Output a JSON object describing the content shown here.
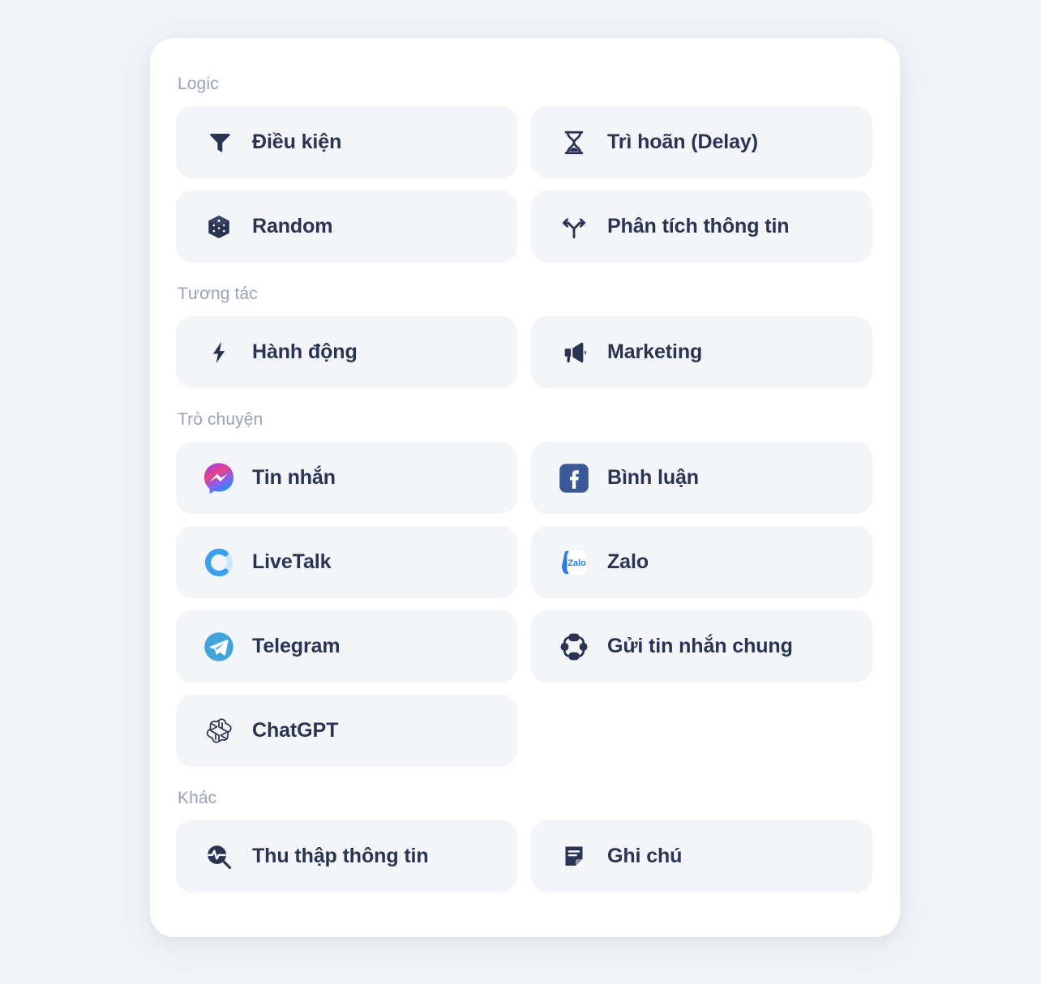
{
  "theme": {
    "page_background": "#f2f4f8",
    "card_background": "#ffffff",
    "tile_background": "#f4f5f9",
    "label_color": "#2a3452",
    "section_title_color": "#9aa2b4",
    "messenger_gradient_start": "#9b4bf5",
    "messenger_gradient_mid": "#f0447a",
    "messenger_gradient_end": "#1292ff",
    "facebook_blue": "#3b5998",
    "telegram_blue": "#41a5dd",
    "livetalk_blue": "#3ba0f0",
    "zalo_blue": "#2a7ce8"
  },
  "sections": [
    {
      "title": "Logic",
      "items": [
        {
          "label": "Điều kiện",
          "icon": "filter-icon"
        },
        {
          "label": "Trì hoãn (Delay)",
          "icon": "hourglass-icon"
        },
        {
          "label": "Random",
          "icon": "dice-icon"
        },
        {
          "label": "Phân tích thông tin",
          "icon": "split-arrows-icon"
        }
      ]
    },
    {
      "title": "Tương tác",
      "items": [
        {
          "label": "Hành động",
          "icon": "lightning-bolt-icon"
        },
        {
          "label": "Marketing",
          "icon": "megaphone-icon"
        }
      ]
    },
    {
      "title": "Trò chuyện",
      "items": [
        {
          "label": "Tin nhắn",
          "icon": "messenger-icon"
        },
        {
          "label": "Bình luận",
          "icon": "facebook-icon"
        },
        {
          "label": "LiveTalk",
          "icon": "livetalk-ring-icon"
        },
        {
          "label": "Zalo",
          "icon": "zalo-icon"
        },
        {
          "label": "Telegram",
          "icon": "telegram-icon"
        },
        {
          "label": "Gửi tin nhắn chung",
          "icon": "broadcast-nodes-icon"
        },
        {
          "label": "ChatGPT",
          "icon": "openai-icon"
        }
      ]
    },
    {
      "title": "Khác",
      "items": [
        {
          "label": "Thu thập thông tin",
          "icon": "pulse-search-icon"
        },
        {
          "label": "Ghi chú",
          "icon": "note-icon"
        }
      ]
    }
  ],
  "zalo_wordmark": "Zalo"
}
